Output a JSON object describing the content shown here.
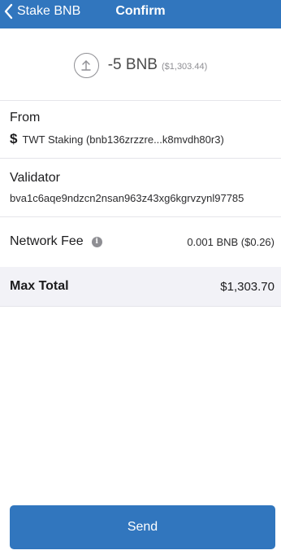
{
  "header": {
    "back_label": "Stake BNB",
    "title": "Confirm"
  },
  "summary": {
    "amount": "-5 BNB",
    "amount_fiat": "($1,303.44)"
  },
  "from": {
    "label": "From",
    "value": "TWT Staking (bnb136zrzzre...k8mvdh80r3)"
  },
  "validator": {
    "label": "Validator",
    "value": "bva1c6aqe9ndzcn2nsan963z43xg6kgrvzynl97785"
  },
  "network_fee": {
    "label": "Network Fee",
    "value": "0.001 BNB ($0.26)"
  },
  "max_total": {
    "label": "Max Total",
    "value": "$1,303.70"
  },
  "send_button": {
    "label": "Send"
  },
  "colors": {
    "accent": "#3176be",
    "total_background": "#f2f2f7"
  },
  "icons": [
    "chevron-left-icon",
    "upload-arrow-icon",
    "dollar-icon",
    "info-icon"
  ]
}
